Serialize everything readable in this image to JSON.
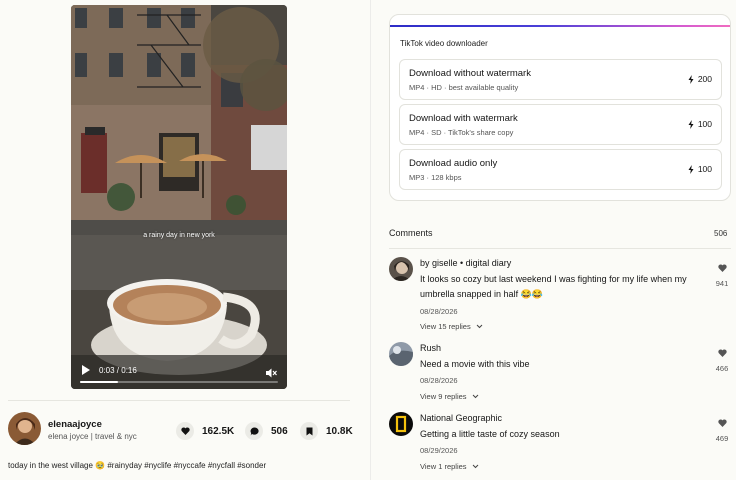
{
  "video": {
    "overlay_text": "a rainy day in new york",
    "time": "0:03 / 0:16",
    "progress_fraction": 0.19
  },
  "author": {
    "name": "elenaajoyce",
    "subtitle": "elena joyce | travel & nyc"
  },
  "stats": {
    "likes": "162.5K",
    "comments": "506",
    "saves": "10.8K"
  },
  "caption": "today in the west village 🥹 #rainyday #nyclife #nyccafe #nycfall #sonder",
  "downloader": {
    "title": "TikTok video downloader",
    "options": [
      {
        "title": "Download without watermark",
        "subtitle": "MP4 · HD · best available quality",
        "cost": "200"
      },
      {
        "title": "Download with watermark",
        "subtitle": "MP4 · SD · TikTok's share copy",
        "cost": "100"
      },
      {
        "title": "Download audio only",
        "subtitle": "MP3 · 128 kbps",
        "cost": "100"
      }
    ],
    "gradient_colors": [
      "#2d2cc7",
      "#f06cc0"
    ]
  },
  "comments_section": {
    "label": "Comments",
    "count": "506",
    "items": [
      {
        "author": "by giselle • digital diary",
        "text": "It looks so cozy but last weekend I was fighting for my life when my umbrella snapped in half 😂😂",
        "date": "08/28/2026",
        "replies": "View 15 replies",
        "likes": "941"
      },
      {
        "author": "Rush",
        "text": "Need a movie with this vibe",
        "date": "08/28/2026",
        "replies": "View 9 replies",
        "likes": "466"
      },
      {
        "author": "National Geographic",
        "text": "Getting a little taste of cozy season",
        "date": "08/29/2026",
        "replies": "View 1 replies",
        "likes": "469"
      }
    ]
  }
}
